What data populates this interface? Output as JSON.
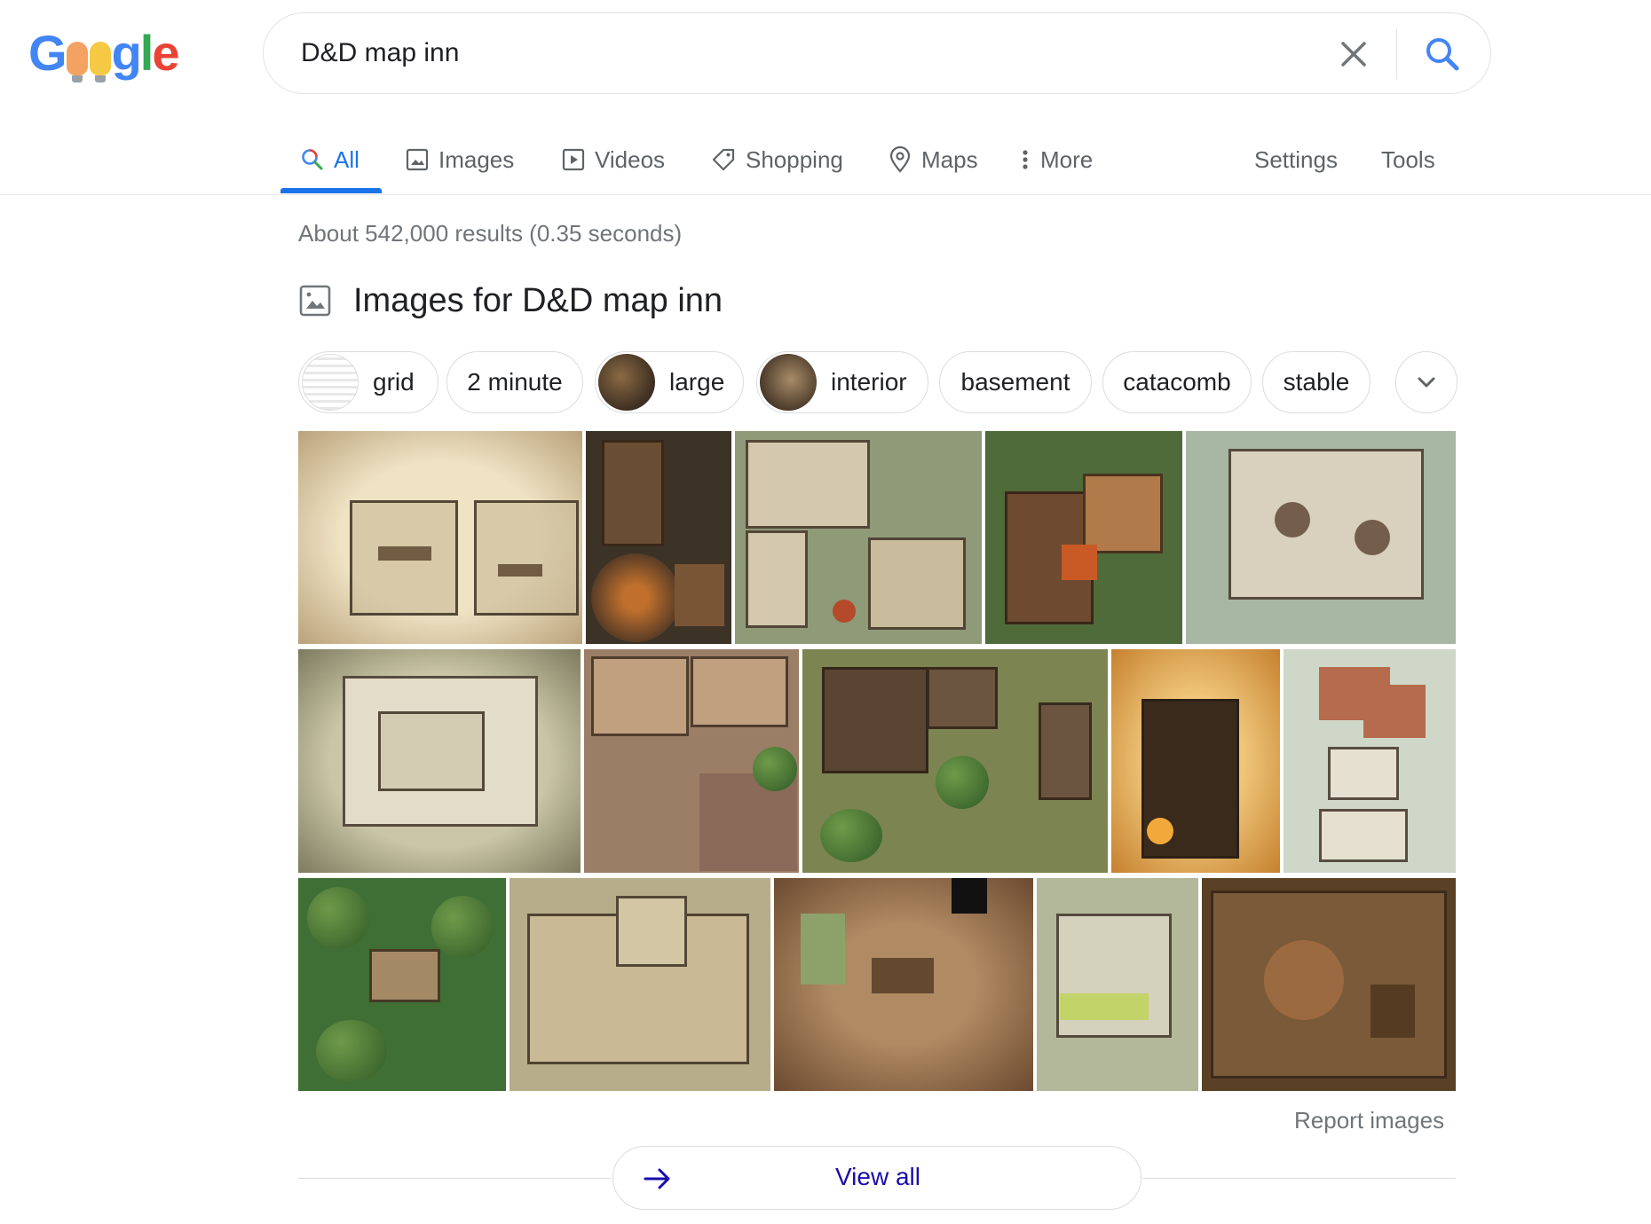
{
  "logo": {
    "letters": [
      "G",
      "g",
      "l",
      "e"
    ]
  },
  "search": {
    "query": "D&D map inn",
    "clear_icon": "close-icon",
    "submit_icon": "search-icon"
  },
  "tabs": [
    {
      "label": "All",
      "icon": "search-icon",
      "active": true
    },
    {
      "label": "Images",
      "icon": "image-icon"
    },
    {
      "label": "Videos",
      "icon": "play-icon"
    },
    {
      "label": "Shopping",
      "icon": "tag-icon"
    },
    {
      "label": "Maps",
      "icon": "map-pin-icon"
    },
    {
      "label": "More",
      "icon": "more-vert-icon"
    }
  ],
  "tools": {
    "settings": "Settings",
    "tools": "Tools"
  },
  "results_stats": "About 542,000 results (0.35 seconds)",
  "images_section": {
    "title": "Images for D&D map inn",
    "chips": [
      "grid",
      "2 minute",
      "large",
      "interior",
      "basement",
      "catacomb",
      "stable"
    ],
    "report": "Report images",
    "view_all": "View all"
  },
  "colors": {
    "accent": "#1a73e8",
    "link": "#1a0dab",
    "muted": "#70757a"
  }
}
